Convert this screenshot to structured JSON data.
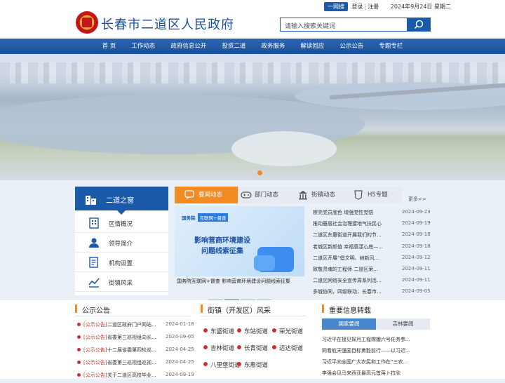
{
  "header": {
    "site_title": "长春市二道区人民政府",
    "top_links": {
      "tag": "一网搜",
      "login": "登录",
      "register": "注册",
      "date": "2024年9月24日 星期二"
    },
    "search_placeholder": "请输入搜索关键词"
  },
  "nav": [
    "首 页",
    "工作动态",
    "政府信息公开",
    "投资二道",
    "政务服务",
    "解读回应",
    "公示公告",
    "专题专栏"
  ],
  "window": {
    "title": "二道之窗",
    "items": [
      {
        "label": "区情概况",
        "icon": "building-icon"
      },
      {
        "label": "领导简介",
        "icon": "person-icon"
      },
      {
        "label": "机构设置",
        "icon": "document-icon"
      },
      {
        "label": "街镇风采",
        "icon": "chart-icon"
      }
    ]
  },
  "news_tabs": {
    "tabs": [
      "要闻动态",
      "部门动态",
      "街镇动态",
      "H5专题"
    ],
    "active": 0,
    "more": "更多>>",
    "featured": {
      "tag_left": "国务院",
      "tag_right": "互联网+督查",
      "line1": "影响营商环境建设",
      "line2": "问题线索征集",
      "caption": "国务院互联网+督查 影响营商环境建设问题线索征集"
    },
    "items": [
      {
        "title": "擦亮党员底色 增强党性觉悟",
        "date": "2024-09-23"
      },
      {
        "title": "推动基层社会治理接地气扶民心",
        "date": "2024-09-19"
      },
      {
        "title": "二道区东惠街道开展我们的节...",
        "date": "2024-09-18"
      },
      {
        "title": "老城区新颜值 幸福感漾心底—...",
        "date": "2024-09-18"
      },
      {
        "title": "二道区开展“倡文明、树新风...",
        "date": "2024-09-12"
      },
      {
        "title": "致敬灵魂的工程师 二道区荣...",
        "date": "2024-09-11"
      },
      {
        "title": "二道区网络安全宣传周系列活...",
        "date": "2024-09-11"
      },
      {
        "title": "多城协同，四级联动，长春市...",
        "date": "2024-09-05"
      }
    ]
  },
  "announcements": {
    "title": "公示公告",
    "items": [
      {
        "tag": "[公示公告]",
        "text": "二道区政府门户网站...",
        "date": "2024-01-18"
      },
      {
        "tag": "[公示公告]",
        "text": "省委第三巡视组向长...",
        "date": "2024-09-05"
      },
      {
        "tag": "[公示公告]",
        "text": "十二届省委第四轮巡...",
        "date": "2024-04-25"
      },
      {
        "tag": "[公示公告]",
        "text": "省委第三巡视组巡视...",
        "date": "2024-04-25"
      },
      {
        "tag": "[公示公告]",
        "text": "关于二道区高校毕业...",
        "date": "2024-09-19"
      }
    ]
  },
  "streets": {
    "title": "街镇（开发区）风采",
    "items": [
      "东盛街道",
      "东站街道",
      "荣光街道",
      "吉林街道",
      "长青街道",
      "远达街道",
      "八里堡街道",
      "东惠街道"
    ]
  },
  "important": {
    "title": "重要信息转载",
    "tabs": [
      "国家要闻",
      "吉林要闻"
    ],
    "items": [
      "习近平在接见探月工程嫦娥六号任务参...",
      "同看航天强国目标勇毅前行——以习近...",
      "习近平向全国广大农民和工作在“三农...",
      "李强会见马来西亚最高元首蒋卜拉欣"
    ]
  },
  "colors": {
    "primary": "#1a5aa8",
    "accent": "#f08a24",
    "alert": "#c83232"
  }
}
